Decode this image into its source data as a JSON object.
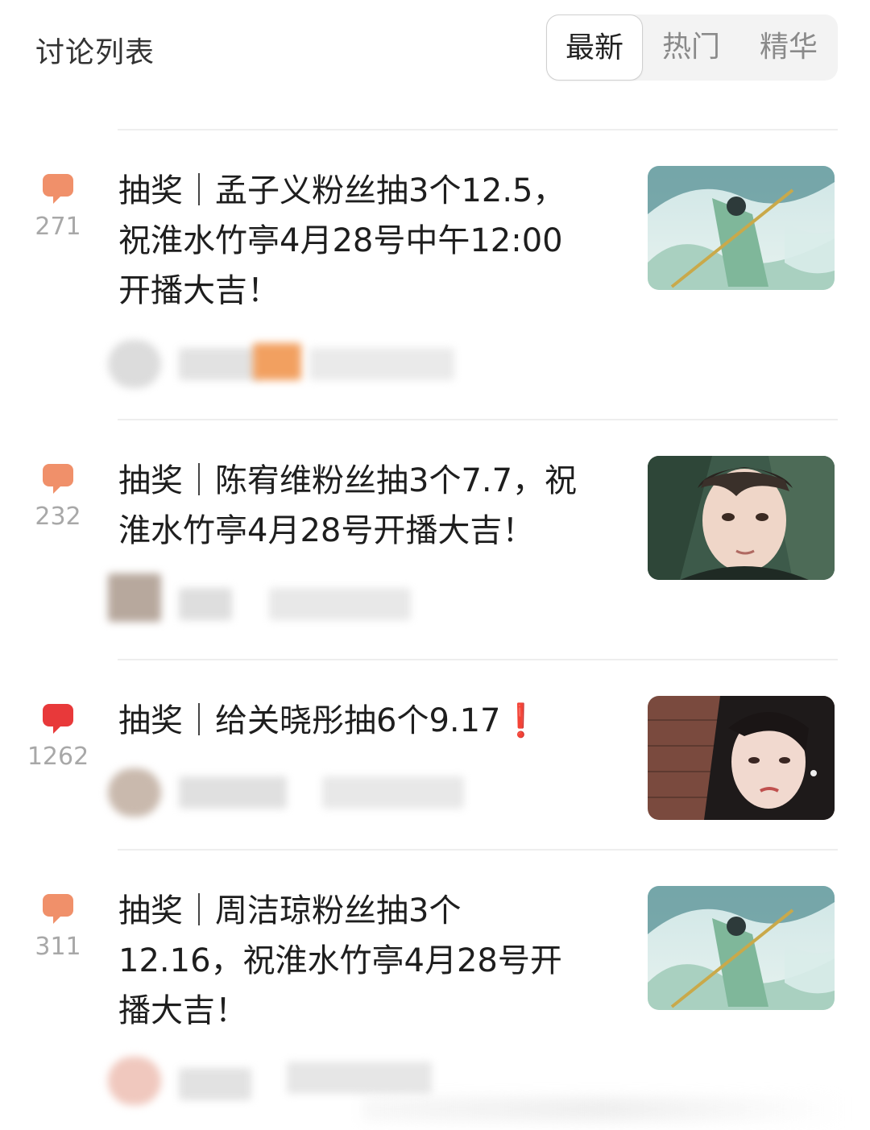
{
  "header": {
    "title": "讨论列表",
    "tabs": [
      {
        "label": "最新",
        "active": true
      },
      {
        "label": "热门",
        "active": false
      },
      {
        "label": "精华",
        "active": false
      }
    ]
  },
  "colors": {
    "bubble_normal": "#f0906a",
    "bubble_hot": "#e8393a",
    "count": "#a8a8a8"
  },
  "posts": [
    {
      "comment_count": "271",
      "title": "抽奖｜孟子义粉丝抽3个12.5，\n祝淮水竹亭4月28号中午12:00\n开播大吉！",
      "thumbnail": "illustrated-poster-green-robed-swordswoman",
      "bubble_icon": "comment-bubble-icon"
    },
    {
      "comment_count": "232",
      "title": "抽奖｜陈宥维粉丝抽3个7.7，祝\n淮水竹亭4月28号开播大吉！",
      "thumbnail": "portrait-male-actor",
      "bubble_icon": "comment-bubble-icon"
    },
    {
      "comment_count": "1262",
      "title": "抽奖｜给关晓彤抽6个9.17❗",
      "thumbnail": "portrait-female-actor-brick-wall",
      "bubble_icon": "comment-bubble-hot-icon"
    },
    {
      "comment_count": "311",
      "title": "抽奖｜周洁琼粉丝抽3个\n12.16，祝淮水竹亭4月28号开\n播大吉！",
      "thumbnail": "illustrated-poster-green-robed-swordswoman",
      "bubble_icon": "comment-bubble-icon"
    }
  ]
}
